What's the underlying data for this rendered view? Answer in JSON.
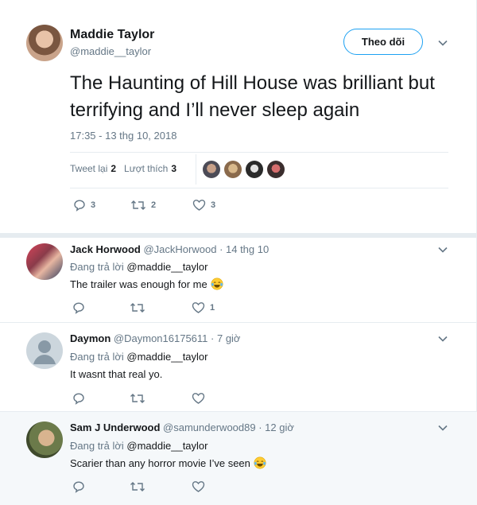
{
  "tweet": {
    "author_name": "Maddie Taylor",
    "author_handle": "@maddie__taylor",
    "follow_label": "Theo dõi",
    "text": "The Haunting of Hill House was brilliant but terrifying and I’ll never sleep again",
    "timestamp": "17:35 - 13 thg 10, 2018",
    "retweets_label": "Tweet lại",
    "retweets_count": "2",
    "likes_label": "Lượt thích",
    "likes_count": "3",
    "reply_count": "3",
    "retweet_count": "2",
    "like_count": "3"
  },
  "replies": [
    {
      "name": "Jack Horwood",
      "handle": "@JackHorwood",
      "time": "· 14 thg 10",
      "replying_to_label": "Đang trả lời",
      "replying_to": "@maddie__taylor",
      "text": "The trailer was enough for me",
      "like_count": "1"
    },
    {
      "name": "Daymon",
      "handle": "@Daymon16175611",
      "time": "· 7 giờ",
      "replying_to_label": "Đang trả lời",
      "replying_to": "@maddie__taylor",
      "text": "It wasnt that real yo.",
      "like_count": ""
    },
    {
      "name": "Sam J Underwood",
      "handle": "@samunderwood89",
      "time": "· 12 giờ",
      "replying_to_label": "Đang trả lời",
      "replying_to": "@maddie__taylor",
      "text": "Scarier than any horror movie I’ve seen",
      "like_count": ""
    }
  ],
  "colors": {
    "accent": "#1da1f2",
    "muted": "#657786",
    "text": "#14171a",
    "divider": "#e6ecf0",
    "reply_highlight_bg": "#f5f8fa"
  },
  "icons": [
    "reply-icon",
    "retweet-icon",
    "like-icon",
    "chevron-down-icon",
    "tears-of-joy-emoji"
  ]
}
